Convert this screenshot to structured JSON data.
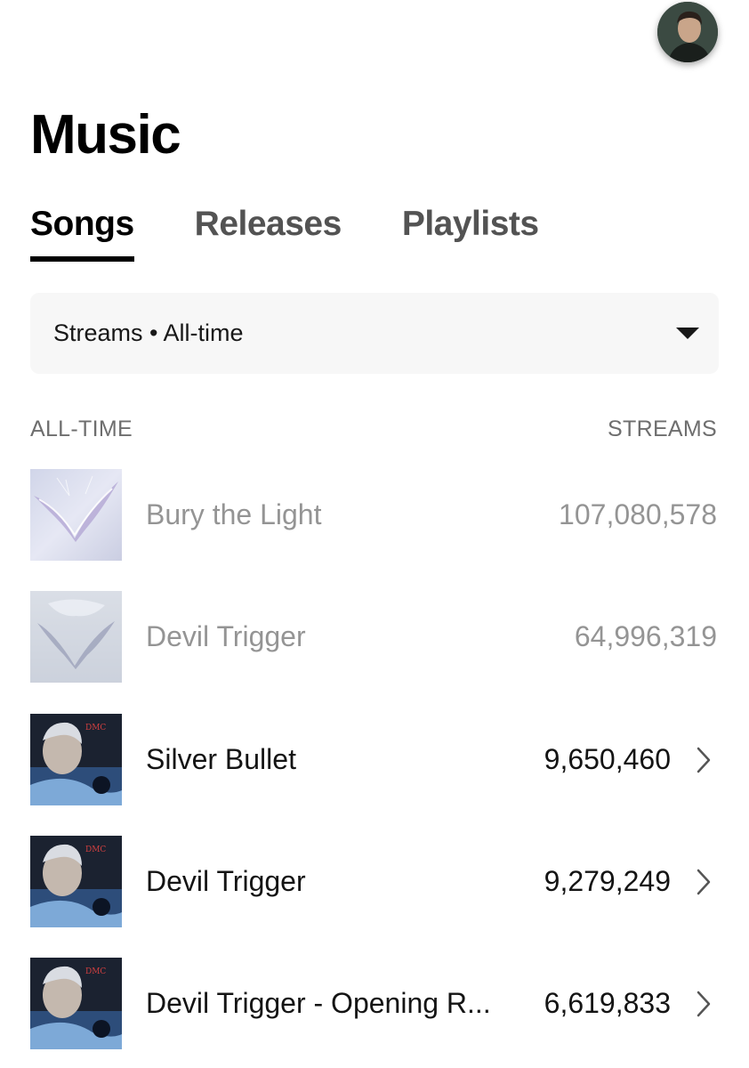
{
  "header": {
    "title": "Music",
    "avatar_icon": "profile-avatar"
  },
  "tabs": [
    {
      "label": "Songs",
      "active": true
    },
    {
      "label": "Releases",
      "active": false
    },
    {
      "label": "Playlists",
      "active": false
    }
  ],
  "filter": {
    "label": "Streams • All-time",
    "icon": "caret-down-icon"
  },
  "columns": {
    "left": "ALL-TIME",
    "right": "STREAMS"
  },
  "songs": [
    {
      "title": "Bury the Light",
      "streams": "107,080,578",
      "dimmed": true,
      "has_chevron": false,
      "art": "winged-emblem-light"
    },
    {
      "title": "Devil Trigger",
      "streams": "64,996,319",
      "dimmed": true,
      "has_chevron": false,
      "art": "winged-emblem-frost"
    },
    {
      "title": "Silver Bullet",
      "streams": "9,650,460",
      "dimmed": false,
      "has_chevron": true,
      "art": "game-cover-portrait"
    },
    {
      "title": "Devil Trigger",
      "streams": "9,279,249",
      "dimmed": false,
      "has_chevron": true,
      "art": "game-cover-portrait"
    },
    {
      "title": "Devil Trigger - Opening R...",
      "streams": "6,619,833",
      "dimmed": false,
      "has_chevron": true,
      "art": "game-cover-portrait"
    }
  ],
  "colors": {
    "text": "#141414",
    "muted": "#6e6e6e",
    "tab_inactive": "#535353",
    "filter_bg": "#f7f7f7"
  }
}
